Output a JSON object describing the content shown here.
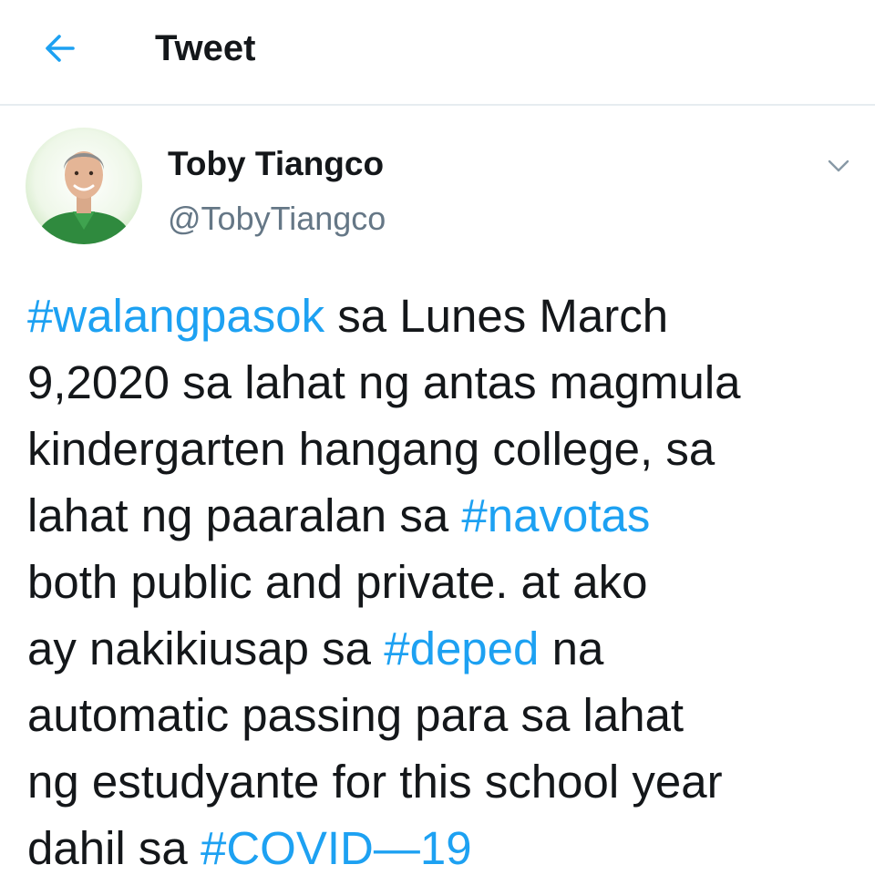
{
  "header": {
    "back_icon": "arrow-left-icon",
    "title": "Tweet"
  },
  "author": {
    "avatar_icon": "profile-photo",
    "name": "Toby Tiangco",
    "handle": "@TobyTiangco",
    "menu_icon": "chevron-down-icon"
  },
  "tweet": {
    "lines": [
      [
        {
          "t": "#walangpasok",
          "tag": true
        },
        {
          "t": " sa Lunes March",
          "tag": false
        }
      ],
      [
        {
          "t": "9,2020 sa lahat ng antas magmula",
          "tag": false
        }
      ],
      [
        {
          "t": "kindergarten hangang college, sa",
          "tag": false
        }
      ],
      [
        {
          "t": "lahat ng paaralan sa ",
          "tag": false
        },
        {
          "t": "#navotas",
          "tag": true
        }
      ],
      [
        {
          "t": "both public and private. at ako",
          "tag": false
        }
      ],
      [
        {
          "t": "ay nakikiusap sa ",
          "tag": false
        },
        {
          "t": "#deped",
          "tag": true
        },
        {
          "t": " na",
          "tag": false
        }
      ],
      [
        {
          "t": "automatic passing para sa lahat",
          "tag": false
        }
      ],
      [
        {
          "t": "ng estudyante for this school year",
          "tag": false
        }
      ],
      [
        {
          "t": "dahil sa ",
          "tag": false
        },
        {
          "t": "#COVID—19",
          "tag": true
        }
      ]
    ]
  },
  "colors": {
    "accent": "#1da1f2",
    "text": "#14171a",
    "secondary": "#657786",
    "divider": "#e6ecf0"
  }
}
